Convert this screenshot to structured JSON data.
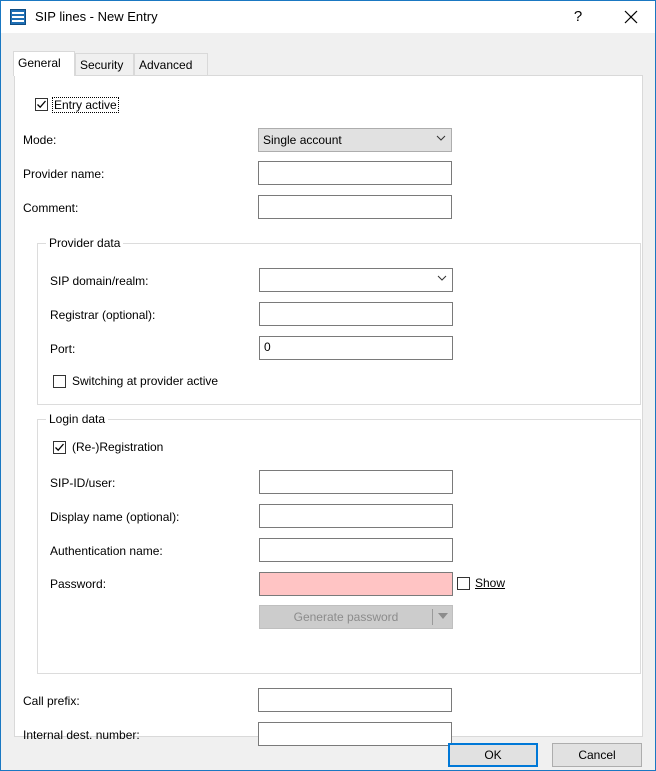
{
  "window": {
    "title": "SIP lines - New Entry",
    "help": "?",
    "close": "×"
  },
  "tabs": [
    {
      "label": "General",
      "active": true
    },
    {
      "label": "Security",
      "active": false
    },
    {
      "label": "Advanced",
      "active": false
    }
  ],
  "general": {
    "entry_active": {
      "label": "Entry active",
      "checked": true
    },
    "mode": {
      "label": "Mode:",
      "value": "Single account"
    },
    "provider_name": {
      "label": "Provider name:",
      "value": ""
    },
    "comment": {
      "label": "Comment:",
      "value": ""
    }
  },
  "provider_data": {
    "title": "Provider data",
    "sip_domain": {
      "label": "SIP domain/realm:",
      "value": ""
    },
    "registrar": {
      "label": "Registrar (optional):",
      "value": ""
    },
    "port": {
      "label": "Port:",
      "value": "0"
    },
    "switching": {
      "label": "Switching at provider active",
      "checked": false
    }
  },
  "login_data": {
    "title": "Login data",
    "registration": {
      "label": "(Re-)Registration",
      "checked": true
    },
    "sip_id": {
      "label": "SIP-ID/user:",
      "value": ""
    },
    "display_name": {
      "label": "Display name (optional):",
      "value": ""
    },
    "auth_name": {
      "label": "Authentication name:",
      "value": ""
    },
    "password": {
      "label": "Password:",
      "value": "",
      "highlight": "#ffc4c4"
    },
    "show": {
      "label": "Show",
      "checked": false
    },
    "generate_password": {
      "label": "Generate password",
      "enabled": false
    }
  },
  "bottom": {
    "call_prefix": {
      "label": "Call prefix:",
      "value": ""
    },
    "internal_dest": {
      "label": "Internal dest. number:",
      "value": ""
    }
  },
  "buttons": {
    "ok": "OK",
    "cancel": "Cancel"
  },
  "colors": {
    "window_border": "#1a78c2",
    "accent": "#0078d7",
    "error_field": "#ffc4c4"
  }
}
